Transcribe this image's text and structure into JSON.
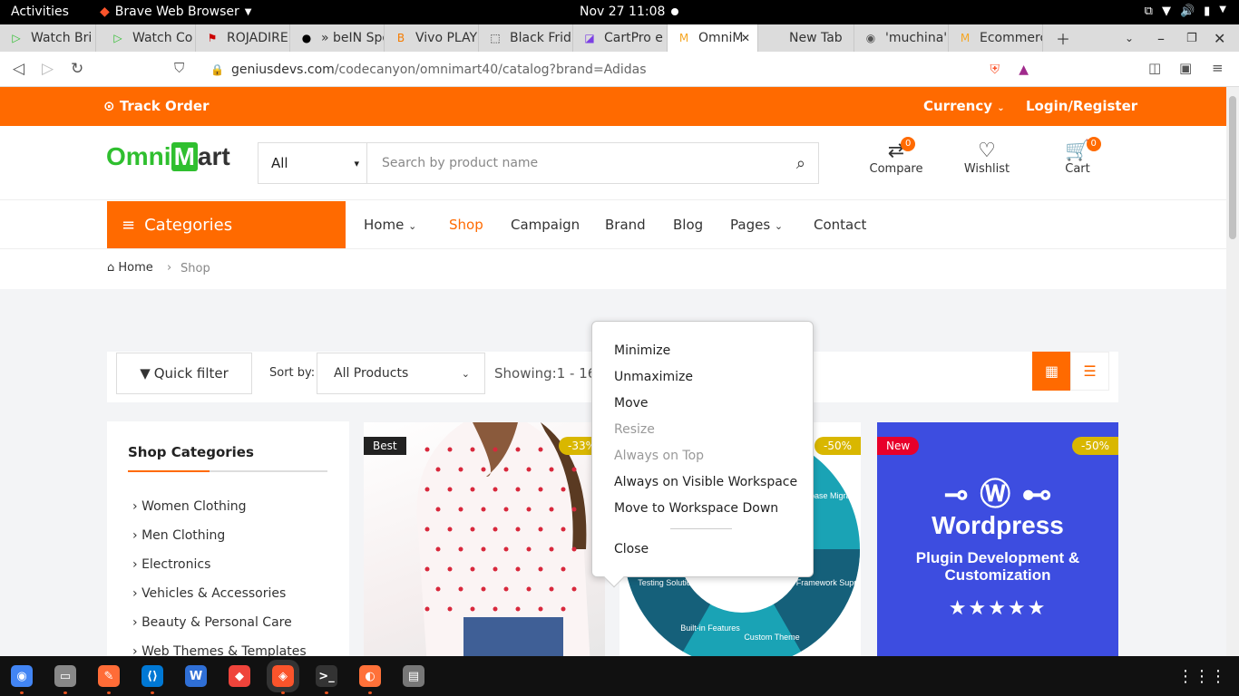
{
  "system_bar": {
    "activities": "Activities",
    "app_name": "Brave Web Browser",
    "clock": "Nov 27  11:08"
  },
  "tabs": [
    {
      "label": "Watch Bri",
      "icon": "play-icon",
      "color": "#2fbf2f"
    },
    {
      "label": "Watch Co",
      "icon": "play-icon",
      "color": "#2fbf2f"
    },
    {
      "label": "ROJADIRE",
      "icon": "flag-icon",
      "color": "#c00"
    },
    {
      "label": "» beIN Spo",
      "icon": "ball-icon",
      "color": "#000"
    },
    {
      "label": "Vivo PLAY",
      "icon": "blogger-icon",
      "color": "#f57c00"
    },
    {
      "label": "Black Frid",
      "icon": "frame-icon",
      "color": "#333"
    },
    {
      "label": "CartPro e",
      "icon": "cart-icon",
      "color": "#7b3fe4"
    },
    {
      "label": "OmniM",
      "icon": "omnimart-icon",
      "color": "#f5a623"
    },
    {
      "label": "New Tab",
      "icon": "",
      "color": ""
    },
    {
      "label": "'muchina'",
      "icon": "globe-icon",
      "color": "#555"
    },
    {
      "label": "Ecommerc",
      "icon": "omnimart-icon",
      "color": "#f5a623"
    }
  ],
  "address": {
    "url_domain": "geniusdevs.com",
    "url_path": "/codecanyon/omnimart40/catalog?brand=Adidas"
  },
  "site": {
    "track_order": "Track Order",
    "currency": "Currency",
    "login": "Login/Register",
    "logo_green": "Omni",
    "logo_bag": "M",
    "logo_dark": "art",
    "search_category": "All",
    "search_placeholder": "Search by product name",
    "compare_label": "Compare",
    "compare_count": "0",
    "wishlist_label": "Wishlist",
    "cart_label": "Cart",
    "cart_count": "0",
    "categories_label": "Categories",
    "nav": {
      "home": "Home",
      "shop": "Shop",
      "campaign": "Campaign",
      "brand": "Brand",
      "blog": "Blog",
      "pages": "Pages",
      "contact": "Contact"
    },
    "breadcrumb": {
      "home": "Home",
      "current": "Shop"
    },
    "toolbar": {
      "quick_filter": "Quick filter",
      "sort_by": "Sort by:",
      "sort_value": "All Products",
      "showing": "Showing:1 - 16 i"
    },
    "shop_categories_title": "Shop Categories",
    "categories": [
      "Women Clothing",
      "Men Clothing",
      "Electronics",
      "Vehicles & Accessories",
      "Beauty & Personal Care",
      "Web Themes & Templates"
    ],
    "products": [
      {
        "tag": "Best",
        "tag_color": "#222",
        "discount": "-33%"
      },
      {
        "tag": "",
        "tag_color": "",
        "discount": "-50%",
        "segments": [
          "Database Migration",
          "Micro Framework Support",
          "Custom Theme",
          "Built-in Features",
          "Testing Solution"
        ]
      },
      {
        "tag": "New",
        "tag_color": "#e8002a",
        "discount": "-50%",
        "title": "Wordpress",
        "subtitle": "Plugin Development & Customization",
        "stars": "★★★★★"
      }
    ]
  },
  "context_menu": {
    "items": [
      {
        "label": "Minimize",
        "enabled": true
      },
      {
        "label": "Unmaximize",
        "enabled": true
      },
      {
        "label": "Move",
        "enabled": true
      },
      {
        "label": "Resize",
        "enabled": false
      },
      {
        "label": "Always on Top",
        "enabled": false
      },
      {
        "label": "Always on Visible Workspace",
        "enabled": true
      },
      {
        "label": "Move to Workspace Down",
        "enabled": true
      }
    ],
    "close": "Close"
  },
  "dock": [
    {
      "name": "chrome-icon",
      "color": "#4285f4"
    },
    {
      "name": "files-icon",
      "color": "#888"
    },
    {
      "name": "postman-icon",
      "color": "#ff6c37"
    },
    {
      "name": "vscode-icon",
      "color": "#0078d4"
    },
    {
      "name": "wps-icon",
      "color": "#2f6fd6"
    },
    {
      "name": "anydesk-icon",
      "color": "#ef443b"
    },
    {
      "name": "brave-icon",
      "color": "#fb542b"
    },
    {
      "name": "terminal-icon",
      "color": "#333"
    },
    {
      "name": "firefox-icon",
      "color": "#ff7139"
    },
    {
      "name": "drive-icon",
      "color": "#777"
    }
  ]
}
